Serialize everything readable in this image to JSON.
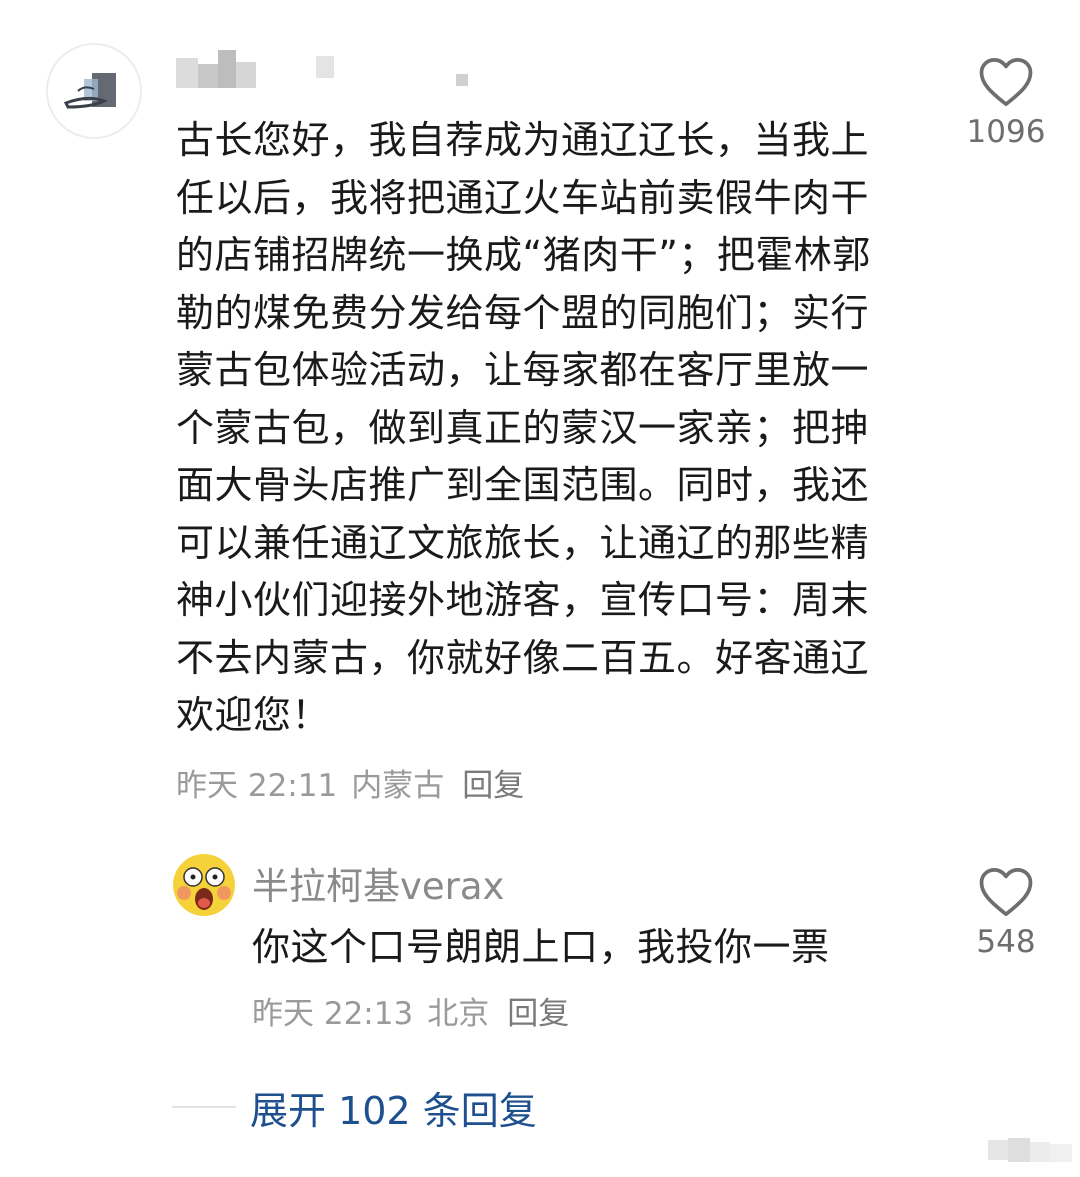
{
  "main_comment": {
    "text": "古长您好，我自荐成为通辽辽长，当我上任以后，我将把通辽火车站前卖假牛肉干的店铺招牌统一换成“猪肉干”；把霍林郭勒的煤免费分发给每个盟的同胞们；实行蒙古包体验活动，让每家都在客厅里放一个蒙古包，做到真正的蒙汉一家亲；把抻面大骨头店推广到全国范围。同时，我还可以兼任通辽文旅旅长，让通辽的那些精神小伙们迎接外地游客，宣传口号：周末不去内蒙古，你就好像二百五。好客通辽欢迎您！",
    "time": "昨天 22:11",
    "location": "内蒙古",
    "reply_label": "回复",
    "likes": "1096"
  },
  "reply": {
    "username": "半拉柯基verax",
    "text": "你这个口号朗朗上口，我投你一票",
    "time": "昨天 22:13",
    "location": "北京",
    "reply_label": "回复",
    "likes": "548"
  },
  "expand_label": "展开 102 条回复",
  "colors": {
    "link": "#1e4f8f",
    "meta": "#9a9a9a",
    "heart": "#6e6e6e"
  }
}
